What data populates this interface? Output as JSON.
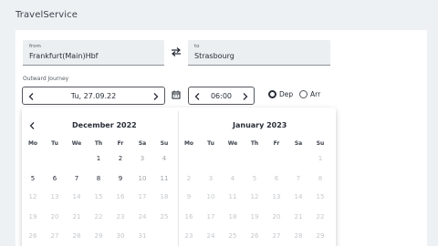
{
  "app": {
    "title": "TravelService"
  },
  "from": {
    "label": "from",
    "value": "Frankfurt(Main)Hbf"
  },
  "to": {
    "label": "to",
    "value": "Strasbourg"
  },
  "outward": {
    "label": "Outward Journey",
    "date": "Tu, 27.09.22",
    "time": "06:00",
    "dep_label": "Dep",
    "arr_label": "Arr",
    "selected": "Dep"
  },
  "icons": {
    "swap": "swap-arrows-icon",
    "calendar": "calendar-icon",
    "prev": "chevron-left-icon",
    "next": "chevron-right-icon"
  },
  "colors": {
    "text": "#282d37",
    "muted": "#a0a4aa",
    "field_bg": "#eceff2",
    "page_bg": "#eef1f4"
  },
  "calendar": {
    "weekdays": [
      "Mo",
      "Tu",
      "We",
      "Th",
      "Fr",
      "Sa",
      "Su"
    ],
    "months": [
      {
        "title": "December 2022",
        "weeks": [
          [
            {
              "d": ""
            },
            {
              "d": ""
            },
            {
              "d": ""
            },
            {
              "d": "1",
              "s": "n"
            },
            {
              "d": "2",
              "s": "n"
            },
            {
              "d": "3",
              "s": "m"
            },
            {
              "d": "4",
              "s": "m"
            }
          ],
          [
            {
              "d": "5",
              "s": "n"
            },
            {
              "d": "6",
              "s": "n"
            },
            {
              "d": "7",
              "s": "n"
            },
            {
              "d": "8",
              "s": "n"
            },
            {
              "d": "9",
              "s": "n"
            },
            {
              "d": "10",
              "s": "m"
            },
            {
              "d": "11",
              "s": "m"
            }
          ],
          [
            {
              "d": "12",
              "s": "x"
            },
            {
              "d": "13",
              "s": "x"
            },
            {
              "d": "14",
              "s": "x"
            },
            {
              "d": "15",
              "s": "x"
            },
            {
              "d": "16",
              "s": "x"
            },
            {
              "d": "17",
              "s": "x"
            },
            {
              "d": "18",
              "s": "x"
            }
          ],
          [
            {
              "d": "19",
              "s": "x"
            },
            {
              "d": "20",
              "s": "x"
            },
            {
              "d": "21",
              "s": "x"
            },
            {
              "d": "22",
              "s": "x"
            },
            {
              "d": "23",
              "s": "x"
            },
            {
              "d": "24",
              "s": "x"
            },
            {
              "d": "25",
              "s": "x"
            }
          ],
          [
            {
              "d": "26",
              "s": "x"
            },
            {
              "d": "27",
              "s": "x"
            },
            {
              "d": "28",
              "s": "x"
            },
            {
              "d": "29",
              "s": "x"
            },
            {
              "d": "30",
              "s": "x"
            },
            {
              "d": "31",
              "s": "x"
            },
            {
              "d": ""
            }
          ]
        ]
      },
      {
        "title": "January 2023",
        "weeks": [
          [
            {
              "d": ""
            },
            {
              "d": ""
            },
            {
              "d": ""
            },
            {
              "d": ""
            },
            {
              "d": ""
            },
            {
              "d": ""
            },
            {
              "d": "1",
              "s": "x"
            }
          ],
          [
            {
              "d": "2",
              "s": "x"
            },
            {
              "d": "3",
              "s": "x"
            },
            {
              "d": "4",
              "s": "x"
            },
            {
              "d": "5",
              "s": "x"
            },
            {
              "d": "6",
              "s": "x"
            },
            {
              "d": "7",
              "s": "x"
            },
            {
              "d": "8",
              "s": "x"
            }
          ],
          [
            {
              "d": "9",
              "s": "x"
            },
            {
              "d": "10",
              "s": "x"
            },
            {
              "d": "11",
              "s": "x"
            },
            {
              "d": "12",
              "s": "x"
            },
            {
              "d": "13",
              "s": "x"
            },
            {
              "d": "14",
              "s": "x"
            },
            {
              "d": "15",
              "s": "x"
            }
          ],
          [
            {
              "d": "16",
              "s": "x"
            },
            {
              "d": "17",
              "s": "x"
            },
            {
              "d": "18",
              "s": "x"
            },
            {
              "d": "19",
              "s": "x"
            },
            {
              "d": "20",
              "s": "x"
            },
            {
              "d": "21",
              "s": "x"
            },
            {
              "d": "22",
              "s": "x"
            }
          ],
          [
            {
              "d": "23",
              "s": "x"
            },
            {
              "d": "24",
              "s": "x"
            },
            {
              "d": "25",
              "s": "x"
            },
            {
              "d": "26",
              "s": "x"
            },
            {
              "d": "27",
              "s": "x"
            },
            {
              "d": "28",
              "s": "x"
            },
            {
              "d": "29",
              "s": "x"
            }
          ]
        ]
      }
    ]
  }
}
